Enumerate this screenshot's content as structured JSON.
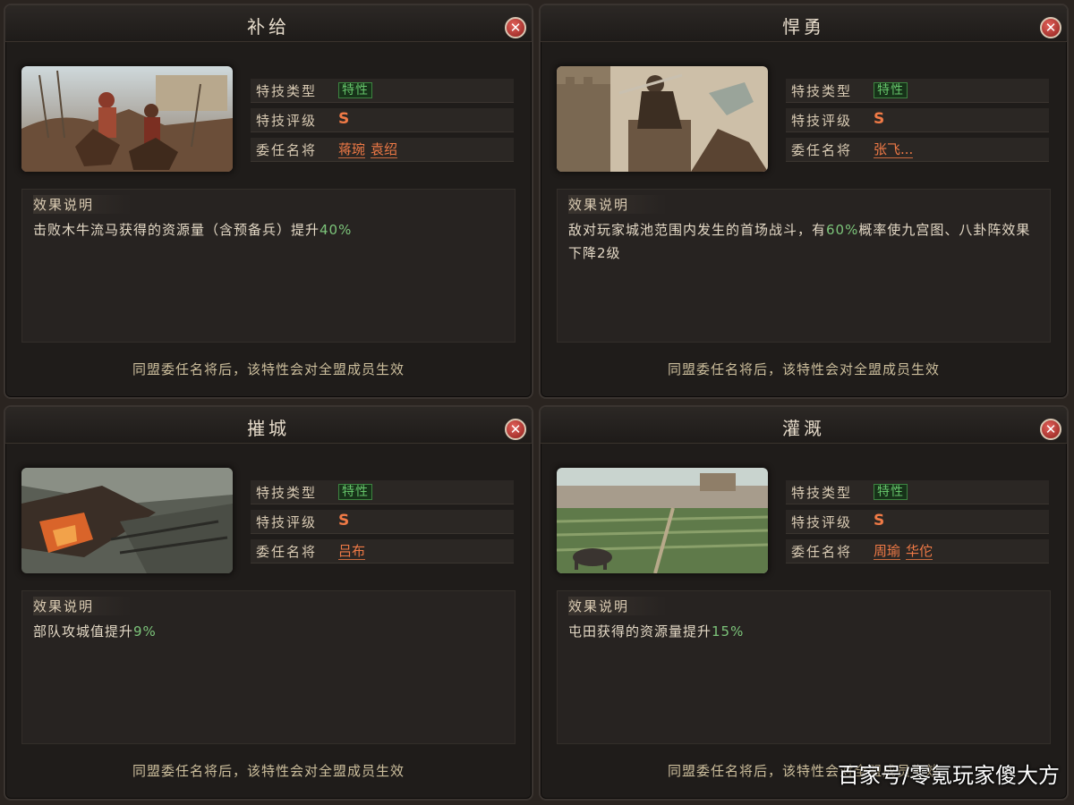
{
  "labels": {
    "skill_type": "特技类型",
    "skill_grade": "特技评级",
    "appoint": "委任名将",
    "effect_header": "效果说明",
    "footer": "同盟委任名将后，该特性会对全盟成员生效"
  },
  "panels": [
    {
      "title": "补给",
      "type": "特性",
      "grade": "S",
      "generals": [
        "蒋琬",
        "袁绍"
      ],
      "desc_before": "击败木牛流马获得的资源量（含预备兵）提升",
      "desc_value": "40%",
      "desc_after": ""
    },
    {
      "title": "悍勇",
      "type": "特性",
      "grade": "S",
      "generals": [
        "张飞..."
      ],
      "desc_before": "敌对玩家城池范围内发生的首场战斗，有",
      "desc_value": "60%",
      "desc_after": "概率使九宫图、八卦阵效果下降2级"
    },
    {
      "title": "摧城",
      "type": "特性",
      "grade": "S",
      "generals": [
        "吕布"
      ],
      "desc_before": "部队攻城值提升",
      "desc_value": "9%",
      "desc_after": ""
    },
    {
      "title": "灌溉",
      "type": "特性",
      "grade": "S",
      "generals": [
        "周瑜",
        "华佗"
      ],
      "desc_before": "屯田获得的资源量提升",
      "desc_value": "15%",
      "desc_after": ""
    }
  ],
  "close_glyph": "✕",
  "watermark": "百家号/零氪玩家傻大方",
  "icons": [
    "close-icon"
  ]
}
